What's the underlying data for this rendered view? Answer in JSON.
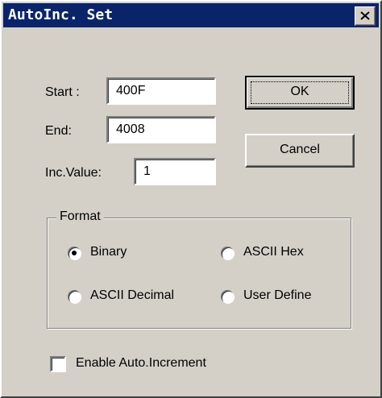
{
  "window": {
    "title": "AutoInc. Set",
    "close_icon": "close-icon"
  },
  "fields": {
    "start_label": "Start :",
    "start_value": "400F",
    "end_label": "End:",
    "end_value": "4008",
    "inc_label": "Inc.Value:",
    "inc_value": "1"
  },
  "buttons": {
    "ok": "OK",
    "cancel": "Cancel"
  },
  "format": {
    "legend": "Format",
    "options": [
      {
        "label": "Binary",
        "selected": true
      },
      {
        "label": "ASCII Hex",
        "selected": false
      },
      {
        "label": "ASCII Decimal",
        "selected": false
      },
      {
        "label": "User Define",
        "selected": false
      }
    ]
  },
  "enable_auto_increment": {
    "label": "Enable Auto.Increment",
    "checked": false
  }
}
